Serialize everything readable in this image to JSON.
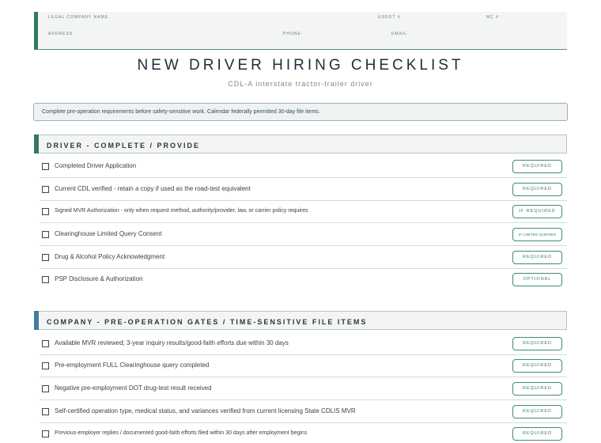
{
  "company": {
    "legal_name_label": "LEGAL COMPANY NAME",
    "usdot_label": "USDOT #",
    "mc_label": "MC #",
    "address_label": "ADDRESS",
    "phone_label": "PHONE",
    "email_label": "EMAIL"
  },
  "title": "NEW DRIVER HIRING CHECKLIST",
  "subtitle": "CDL-A interstate tractor-trailer driver",
  "note": "Complete pre-operation requirements before safety-sensitive work. Calendar federally permitted 30-day file items.",
  "colors": {
    "section1_accent": "#2f7a62",
    "section2_accent": "#3b7fa0",
    "pill_border": "#3f8a78"
  },
  "sections": [
    {
      "title": "DRIVER - COMPLETE / PROVIDE",
      "items": [
        {
          "text": "Completed Driver Application",
          "badge": "REQUIRED"
        },
        {
          "text": "Current CDL verified - retain a copy if used as the road-test equivalent",
          "badge": "REQUIRED"
        },
        {
          "text": "Signed MVR Authorization - only when request method, authority/provider, law, or carrier policy requires",
          "badge": "IF REQUIRED"
        },
        {
          "text": "Clearinghouse Limited Query Consent",
          "badge": "IF LIMITED QUERIES"
        },
        {
          "text": "Drug & Alcohol Policy Acknowledgment",
          "badge": "REQUIRED"
        },
        {
          "text": "PSP Disclosure & Authorization",
          "badge": "OPTIONAL"
        }
      ]
    },
    {
      "title": "COMPANY - PRE-OPERATION GATES / TIME-SENSITIVE FILE ITEMS",
      "items": [
        {
          "text": "Available MVR reviewed; 3-year inquiry results/good-faith efforts due within 30 days",
          "badge": "REQUIRED"
        },
        {
          "text": "Pre-employment FULL Clearinghouse query completed",
          "badge": "REQUIRED"
        },
        {
          "text": "Negative pre-employment DOT drug-test result received",
          "badge": "REQUIRED"
        },
        {
          "text": "Self-certified operation type, medical status, and variances verified from current licensing State CDLIS MVR",
          "badge": "REQUIRED"
        },
        {
          "text": "Previous-employer replies / documented good-faith efforts filed within 30 days after employment begins",
          "badge": "REQUIRED"
        }
      ]
    }
  ]
}
